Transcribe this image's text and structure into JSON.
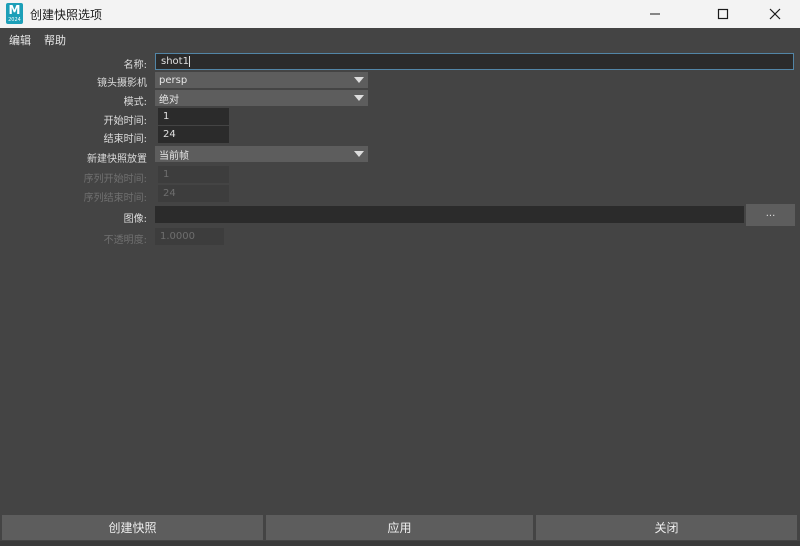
{
  "window": {
    "title": "创建快照选项",
    "icon_letter": "M",
    "icon_sub": "2024"
  },
  "menu": {
    "items": [
      "编辑",
      "帮助"
    ]
  },
  "form": {
    "name_label": "名称:",
    "name_value": "shot1",
    "camera_label": "镜头摄影机",
    "camera_value": "persp",
    "mode_label": "模式:",
    "mode_value": "绝对",
    "start_label": "开始时间:",
    "start_value": "1",
    "end_label": "结束时间:",
    "end_value": "24",
    "placement_label": "新建快照放置",
    "placement_value": "当前帧",
    "seq_start_label": "序列开始时间:",
    "seq_start_value": "1",
    "seq_end_label": "序列结束时间:",
    "seq_end_value": "24",
    "image_label": "图像:",
    "image_value": "",
    "browse_label": "...",
    "opacity_label": "不透明度:",
    "opacity_value": "1.0000"
  },
  "buttons": {
    "create": "创建快照",
    "apply": "应用",
    "close": "关闭"
  },
  "colors": {
    "background": "#444444",
    "field": "#2b2b2b",
    "button": "#5d5d5d",
    "focus_border": "#5285a6",
    "app_icon": "#1c9fb8"
  }
}
